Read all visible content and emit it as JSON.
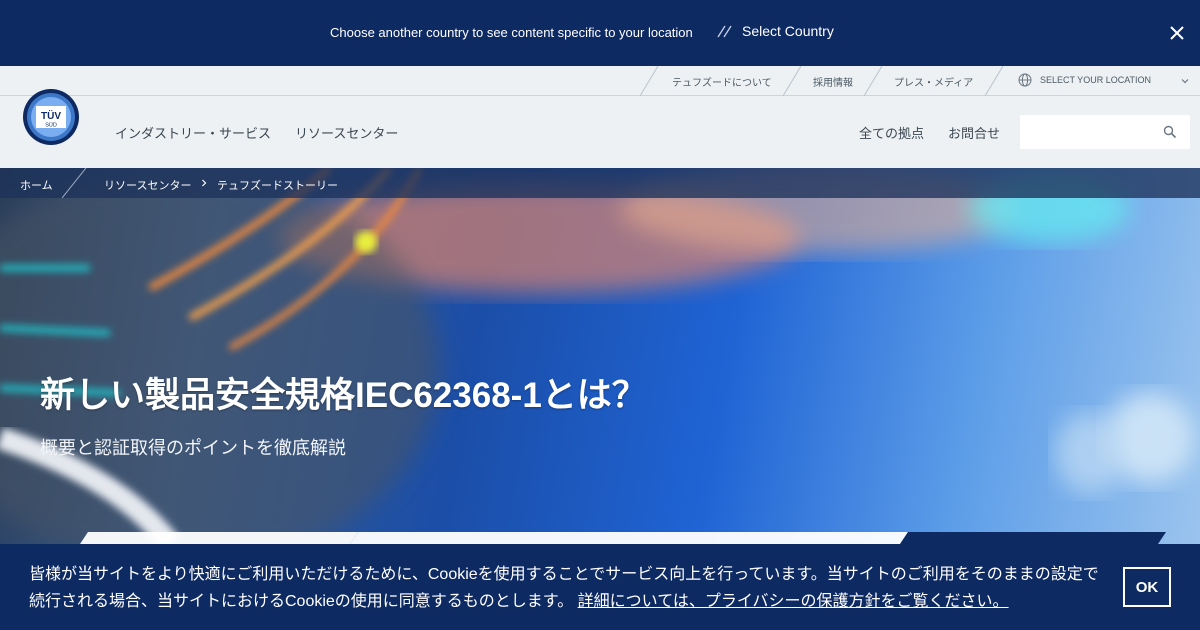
{
  "country_bar": {
    "message": "Choose another country to see content specific to your location",
    "select_label": "Select Country"
  },
  "utility_nav": {
    "items": [
      "テュフズードについて",
      "採用情報",
      "プレス・メディア"
    ],
    "location_label": "SELECT YOUR LOCATION"
  },
  "logo": {
    "line1": "TÜV",
    "line2": "SÜD"
  },
  "main_nav": {
    "left": [
      "インダストリー・サービス",
      "リソースセンター"
    ],
    "right": [
      "全ての拠点",
      "お問合せ"
    ]
  },
  "search": {
    "placeholder": ""
  },
  "breadcrumb": [
    "ホーム",
    "リソースセンター",
    "テュフズードストーリー"
  ],
  "hero": {
    "title": "新しい製品安全規格IEC62368-1とは？",
    "subtitle": "概要と認証取得のポイントを徹底解説"
  },
  "cookie": {
    "text": "皆様が当サイトをより快適にご利用いただけるために、Cookieを使用することでサービス向上を行っています。当サイトのご利用をそのままの設定で続行される場合、当サイトにおけるCookieの使用に同意するものとします。",
    "link": "詳細については、プライバシーの保護方針をご覧ください。",
    "ok": "OK"
  },
  "colors": {
    "navy": "#0e2a63",
    "header_bg": "#edf1f4",
    "hero_blue": "#1f63d4"
  }
}
